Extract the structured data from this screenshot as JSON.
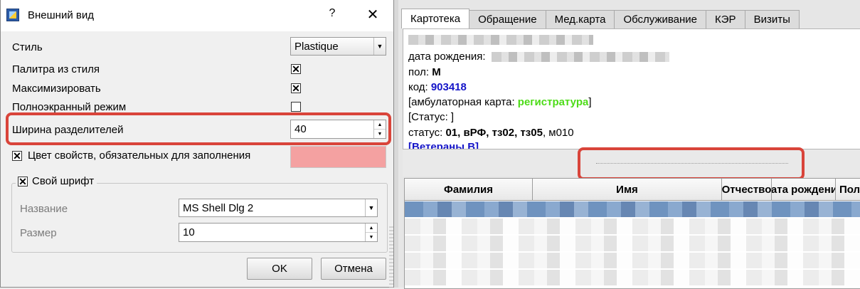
{
  "dialog": {
    "title": "Внешний вид",
    "help_glyph": "?",
    "close_glyph": "✕",
    "style_label": "Стиль",
    "style_value": "Plastique",
    "palette_label": "Палитра из стиля",
    "palette_checked": true,
    "maximize_label": "Максимизировать",
    "maximize_checked": true,
    "fullscreen_label": "Полноэкранный режим",
    "fullscreen_checked": false,
    "splitter_width_label": "Ширина разделителей",
    "splitter_width_value": "40",
    "required_color_label": "Цвет свойств, обязательных для заполнения",
    "required_color_checked": true,
    "required_color": "#f4a1a1",
    "font_group_label": "Свой шрифт",
    "font_group_checked": true,
    "font_name_label": "Название",
    "font_name_value": "MS Shell Dlg 2",
    "font_size_label": "Размер",
    "font_size_value": "10",
    "ok_label": "OK",
    "cancel_label": "Отмена"
  },
  "main": {
    "tabs": [
      "Картотека",
      "Обращение",
      "Мед.карта",
      "Обслуживание",
      "КЭР",
      "Визиты"
    ],
    "active_tab": "Картотека",
    "card": {
      "dob_label": "дата рождения:",
      "sex_label": "пол:",
      "sex_value": "М",
      "code_label": "код:",
      "code_value": "903418",
      "outpatient_prefix": "[амбулаторная карта:",
      "outpatient_value": "регистратура",
      "outpatient_suffix": "]",
      "status_bracket": "[Статус: ]",
      "status_label": "статус:",
      "status_value_bold": "01, вРФ, тз02, тз05",
      "status_value_plain": ", м010",
      "veterans": "[Ветераны В]"
    },
    "table_headers": [
      "Фамилия",
      "Имя",
      "Отчество",
      "Дата рождения",
      "Пол"
    ]
  },
  "colors": {
    "highlight": "#d9443a",
    "selected_row": "#7a9ac4",
    "code_blue": "#1515c8",
    "registry_green": "#4ddc18"
  }
}
